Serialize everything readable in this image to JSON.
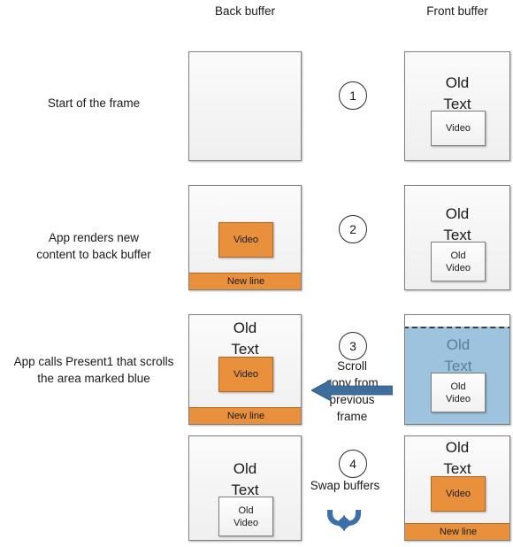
{
  "headers": {
    "back_buffer": "Back buffer",
    "front_buffer": "Front buffer"
  },
  "rows": [
    {
      "label": "Start of the frame",
      "step": "1",
      "caption": "",
      "back_buffer": {
        "lines": [],
        "video_label": "",
        "new_line_label": ""
      },
      "front_buffer": {
        "lines": [
          "Old",
          "Text"
        ],
        "video_label": "Video"
      }
    },
    {
      "label_line1": "App renders new",
      "label_line2": "content to back buffer",
      "step": "2",
      "caption": "",
      "back_buffer": {
        "video_label": "Video",
        "new_line_label": "New line"
      },
      "front_buffer": {
        "lines": [
          "Old",
          "Text"
        ],
        "video_label_line1": "Old",
        "video_label_line2": "Video"
      }
    },
    {
      "label_line1": "App calls Present1 that scrolls",
      "label_line2": "the area marked blue",
      "step": "3",
      "caption_line1": "Scroll",
      "caption_line2": "copy from",
      "caption_line3": "previous",
      "caption_line4": "frame",
      "back_buffer": {
        "lines": [
          "Old",
          "Text"
        ],
        "video_label": "Video",
        "new_line_label": "New line"
      },
      "front_buffer": {
        "lines": [
          "Old",
          "Text"
        ],
        "video_label_line1": "Old",
        "video_label_line2": "Video"
      }
    },
    {
      "label": "",
      "step": "4",
      "caption": "Swap buffers",
      "back_buffer": {
        "lines": [
          "Old",
          "Text"
        ],
        "video_label_line1": "Old",
        "video_label_line2": "Video"
      },
      "front_buffer": {
        "lines": [
          "Old",
          "Text"
        ],
        "video_label": "Video",
        "new_line_label": "New line"
      }
    }
  ],
  "colors": {
    "orange": "#e8903c",
    "orange_border": "#b4681f",
    "blue_region": "#9dc3de",
    "blue_arrow": "#3e6e9e",
    "buffer_border": "#7f7f7f",
    "faded_text": "#5c7f96"
  },
  "icons": {
    "scroll_arrow": "left-arrow-icon",
    "swap": "swap-buffers-icon"
  }
}
